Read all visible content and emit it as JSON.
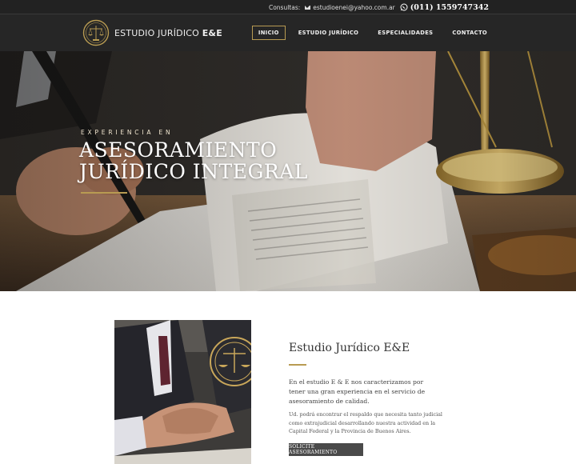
{
  "topbar": {
    "label": "Consultas:",
    "email": "estudioenei@yahoo.com.ar",
    "phone": "(011) 1559747342"
  },
  "header": {
    "brand_prefix": "ESTUDIO JURÍDICO ",
    "brand_bold": "E&E",
    "nav": [
      {
        "label": "INICIO",
        "active": true
      },
      {
        "label": "ESTUDIO JURÍDICO",
        "active": false
      },
      {
        "label": "ESPECIALIDADES",
        "active": false
      },
      {
        "label": "CONTACTO",
        "active": false
      }
    ]
  },
  "hero": {
    "kicker": "EXPERIENCIA EN",
    "title_line1": "ASESORAMIENTO",
    "title_line2": "JURÍDICO INTEGRAL"
  },
  "about": {
    "title": "Estudio Jurídico E&E",
    "paragraph1": "En el estudio E & E nos caracterizamos por tener una gran experiencia en el servicio de asesoramiento de calidad.",
    "paragraph2": "Ud. podrá encontrar el respaldo que necesita tanto judicial como extrajudicial desarrollando nuestra actividad en la Capital Federal y la Provincia de Buenos Aires.",
    "cta_label": "SOLICITE ASESORAMIENTO"
  },
  "colors": {
    "accent_gold": "#b89b52",
    "header_bg": "#262626",
    "topbar_bg": "#222222",
    "cta_bg": "#4a4a4a"
  },
  "icons": [
    "envelope-icon",
    "whatsapp-icon",
    "logo-scales-emblem",
    "seal-emblem"
  ]
}
